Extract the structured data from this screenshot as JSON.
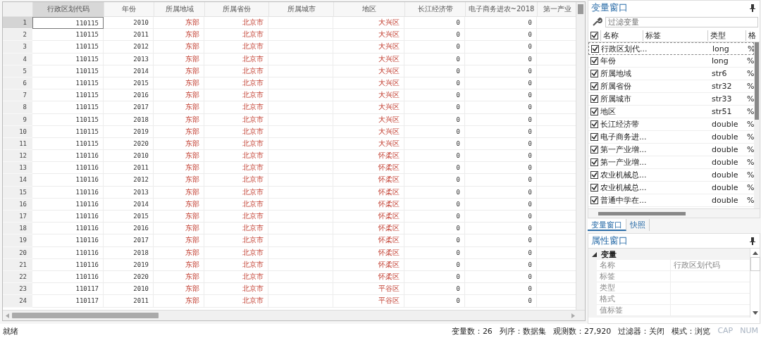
{
  "grid": {
    "columns": [
      {
        "label": "行政区划代码",
        "kind": "numeric",
        "selected": true
      },
      {
        "label": "年份",
        "kind": "numeric",
        "selected": false
      },
      {
        "label": "所属地域",
        "kind": "text",
        "selected": false
      },
      {
        "label": "所属省份",
        "kind": "text",
        "selected": false
      },
      {
        "label": "所属城市",
        "kind": "text",
        "selected": false
      },
      {
        "label": "地区",
        "kind": "text",
        "selected": false
      },
      {
        "label": "长江经济带",
        "kind": "numeric",
        "selected": false
      },
      {
        "label": "电子商务进农~2018",
        "kind": "numeric",
        "selected": false
      },
      {
        "label": "第一产业",
        "selected": false
      }
    ],
    "rows": [
      {
        "n": "1",
        "cells": [
          "110115",
          "2010",
          "东部",
          "北京市",
          null,
          "大兴区",
          "0",
          "0"
        ],
        "selected": true
      },
      {
        "n": "2",
        "cells": [
          "110115",
          "2011",
          "东部",
          "北京市",
          null,
          "大兴区",
          "0",
          "0"
        ],
        "selected": false
      },
      {
        "n": "3",
        "cells": [
          "110115",
          "2012",
          "东部",
          "北京市",
          null,
          "大兴区",
          "0",
          "0"
        ],
        "selected": false
      },
      {
        "n": "4",
        "cells": [
          "110115",
          "2013",
          "东部",
          "北京市",
          null,
          "大兴区",
          "0",
          "0"
        ],
        "selected": false
      },
      {
        "n": "5",
        "cells": [
          "110115",
          "2014",
          "东部",
          "北京市",
          null,
          "大兴区",
          "0",
          "0"
        ],
        "selected": false
      },
      {
        "n": "6",
        "cells": [
          "110115",
          "2015",
          "东部",
          "北京市",
          null,
          "大兴区",
          "0",
          "0"
        ],
        "selected": false
      },
      {
        "n": "7",
        "cells": [
          "110115",
          "2016",
          "东部",
          "北京市",
          null,
          "大兴区",
          "0",
          "0"
        ],
        "selected": false
      },
      {
        "n": "8",
        "cells": [
          "110115",
          "2017",
          "东部",
          "北京市",
          null,
          "大兴区",
          "0",
          "0"
        ],
        "selected": false
      },
      {
        "n": "9",
        "cells": [
          "110115",
          "2018",
          "东部",
          "北京市",
          null,
          "大兴区",
          "0",
          "0"
        ],
        "selected": false
      },
      {
        "n": "10",
        "cells": [
          "110115",
          "2019",
          "东部",
          "北京市",
          null,
          "大兴区",
          "0",
          "0"
        ],
        "selected": false
      },
      {
        "n": "11",
        "cells": [
          "110115",
          "2020",
          "东部",
          "北京市",
          null,
          "大兴区",
          "0",
          "0"
        ],
        "selected": false
      },
      {
        "n": "12",
        "cells": [
          "110116",
          "2010",
          "东部",
          "北京市",
          null,
          "怀柔区",
          "0",
          "0"
        ],
        "selected": false
      },
      {
        "n": "13",
        "cells": [
          "110116",
          "2011",
          "东部",
          "北京市",
          null,
          "怀柔区",
          "0",
          "0"
        ],
        "selected": false
      },
      {
        "n": "14",
        "cells": [
          "110116",
          "2012",
          "东部",
          "北京市",
          null,
          "怀柔区",
          "0",
          "0"
        ],
        "selected": false
      },
      {
        "n": "15",
        "cells": [
          "110116",
          "2013",
          "东部",
          "北京市",
          null,
          "怀柔区",
          "0",
          "0"
        ],
        "selected": false
      },
      {
        "n": "16",
        "cells": [
          "110116",
          "2014",
          "东部",
          "北京市",
          null,
          "怀柔区",
          "0",
          "0"
        ],
        "selected": false
      },
      {
        "n": "17",
        "cells": [
          "110116",
          "2015",
          "东部",
          "北京市",
          null,
          "怀柔区",
          "0",
          "0"
        ],
        "selected": false
      },
      {
        "n": "18",
        "cells": [
          "110116",
          "2016",
          "东部",
          "北京市",
          null,
          "怀柔区",
          "0",
          "0"
        ],
        "selected": false
      },
      {
        "n": "19",
        "cells": [
          "110116",
          "2017",
          "东部",
          "北京市",
          null,
          "怀柔区",
          "0",
          "0"
        ],
        "selected": false
      },
      {
        "n": "20",
        "cells": [
          "110116",
          "2018",
          "东部",
          "北京市",
          null,
          "怀柔区",
          "0",
          "0"
        ],
        "selected": false
      },
      {
        "n": "21",
        "cells": [
          "110116",
          "2019",
          "东部",
          "北京市",
          null,
          "怀柔区",
          "0",
          "0"
        ],
        "selected": false
      },
      {
        "n": "22",
        "cells": [
          "110116",
          "2020",
          "东部",
          "北京市",
          null,
          "怀柔区",
          "0",
          "0"
        ],
        "selected": false
      },
      {
        "n": "23",
        "cells": [
          "110117",
          "2010",
          "东部",
          "北京市",
          null,
          "平谷区",
          "0",
          "0"
        ],
        "selected": false
      },
      {
        "n": "24",
        "cells": [
          "110117",
          "2011",
          "东部",
          "北京市",
          null,
          "平谷区",
          "0",
          "0"
        ],
        "selected": false
      }
    ]
  },
  "variables_window": {
    "title": "变量窗口",
    "filter_placeholder": "过滤变量",
    "header_checked": true,
    "columns": [
      "名称",
      "标签",
      "类型",
      "格"
    ],
    "items": [
      {
        "name": "行政区划代...",
        "type": "long",
        "format": "%",
        "checked": true,
        "selected": true
      },
      {
        "name": "年份",
        "type": "long",
        "format": "%",
        "checked": true,
        "selected": false
      },
      {
        "name": "所属地域",
        "type": "str6",
        "format": "%",
        "checked": true,
        "selected": false
      },
      {
        "name": "所属省份",
        "type": "str32",
        "format": "%",
        "checked": true,
        "selected": false
      },
      {
        "name": "所属城市",
        "type": "str33",
        "format": "%",
        "checked": true,
        "selected": false
      },
      {
        "name": "地区",
        "type": "str51",
        "format": "%",
        "checked": true,
        "selected": false
      },
      {
        "name": "长江经济带",
        "type": "double",
        "format": "%",
        "checked": true,
        "selected": false
      },
      {
        "name": "电子商务进...",
        "type": "double",
        "format": "%",
        "checked": true,
        "selected": false
      },
      {
        "name": "第一产业增...",
        "type": "double",
        "format": "%",
        "checked": true,
        "selected": false
      },
      {
        "name": "第一产业增...",
        "type": "double",
        "format": "%",
        "checked": true,
        "selected": false
      },
      {
        "name": "农业机械总...",
        "type": "double",
        "format": "%",
        "checked": true,
        "selected": false
      },
      {
        "name": "农业机械总...",
        "type": "double",
        "format": "%",
        "checked": true,
        "selected": false
      },
      {
        "name": "普通中学在...",
        "type": "double",
        "format": "%",
        "checked": true,
        "selected": false
      }
    ]
  },
  "tabs": [
    {
      "label": "变量窗口",
      "selected": true
    },
    {
      "label": "快照",
      "selected": false
    }
  ],
  "properties_window": {
    "title": "属性窗口",
    "group": "变量",
    "expanded": true,
    "rows": [
      {
        "name": "名称",
        "value": "行政区划代码"
      },
      {
        "name": "标签"
      },
      {
        "name": "类型"
      },
      {
        "name": "格式"
      },
      {
        "name": "值标签"
      }
    ]
  },
  "status_bar": {
    "left": "就绪",
    "items": [
      {
        "text": "变量数：26",
        "enabled": true
      },
      {
        "text": "列序：数据集",
        "enabled": true
      },
      {
        "text": "观测数：27,920",
        "enabled": true
      },
      {
        "text": "过滤器：关闭",
        "enabled": true
      },
      {
        "text": "模式：浏览",
        "enabled": true
      },
      {
        "text": "CAP",
        "enabled": false
      },
      {
        "text": "NUM",
        "enabled": false
      }
    ]
  }
}
